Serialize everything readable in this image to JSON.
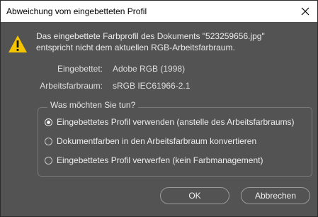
{
  "window": {
    "title": "Abweichung vom eingebetteten Profil",
    "close_icon": "close-icon"
  },
  "message": {
    "icon": "warning-icon",
    "accent_color": "#f5c400",
    "line1": "Das eingebettete Farbprofil des Dokuments \"523259656.jpg\"",
    "line2": "entspricht nicht dem aktuellen RGB-Arbeitsfarbraum."
  },
  "info": {
    "embedded_label": "Eingebettet:",
    "embedded_value": "Adobe RGB (1998)",
    "working_label": "Arbeitsfarbraum:",
    "working_value": "sRGB IEC61966-2.1"
  },
  "choice": {
    "title": "Was möchten Sie tun?",
    "options": [
      {
        "label": "Eingebettetes Profil verwenden (anstelle des Arbeitsfarbraums)",
        "selected": true
      },
      {
        "label": "Dokumentfarben in den Arbeitsfarbraum konvertieren",
        "selected": false
      },
      {
        "label": "Eingebettetes Profil verwerfen (kein Farbmanagement)",
        "selected": false
      }
    ]
  },
  "buttons": {
    "ok": "OK",
    "cancel": "Abbrechen"
  }
}
